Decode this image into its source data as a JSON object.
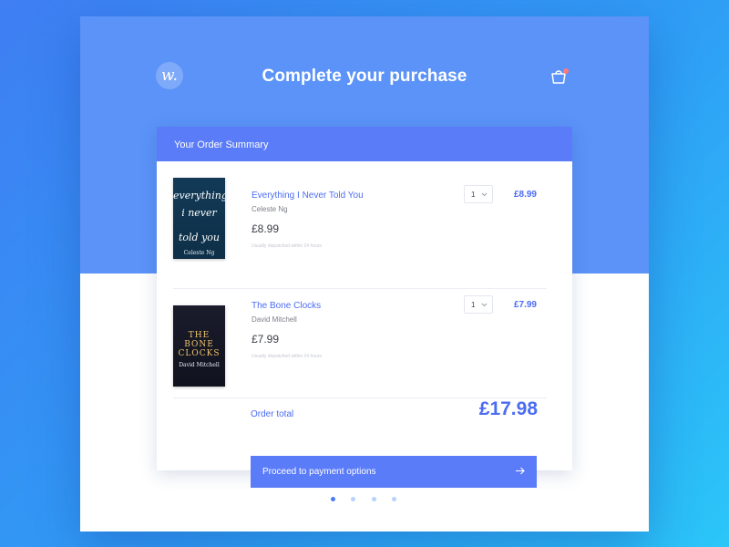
{
  "header": {
    "logo_text": "w.",
    "title": "Complete your purchase",
    "cart_icon": "basket-icon"
  },
  "order_summary": {
    "heading": "Your Order Summary",
    "items": [
      {
        "title": "Everything I Never Told You",
        "author": "Celeste Ng",
        "price": "£8.99",
        "note": "Usually dispatched within 24 hours",
        "quantity": "1",
        "line_total": "£8.99",
        "cover": {
          "line1": "everything",
          "line2": "i never",
          "line3": "told you",
          "author": "Celeste Ng"
        }
      },
      {
        "title": "The Bone Clocks",
        "author": "David Mitchell",
        "price": "£7.99",
        "note": "Usually dispatched within 24 hours",
        "quantity": "1",
        "line_total": "£7.99",
        "cover": {
          "line1": "THE",
          "line2": "BONE",
          "line3": "CLOCKS",
          "author": "David Mitchell"
        }
      }
    ],
    "total_label": "Order total",
    "total_value": "£17.98",
    "proceed_label": "Proceed to payment options"
  },
  "pagination": {
    "count": 4,
    "active_index": 0
  },
  "colors": {
    "hero": "#5b93f8",
    "accent": "#5b7cf8",
    "link": "#4b6cf2",
    "cart_badge": "#ff7a7a"
  }
}
